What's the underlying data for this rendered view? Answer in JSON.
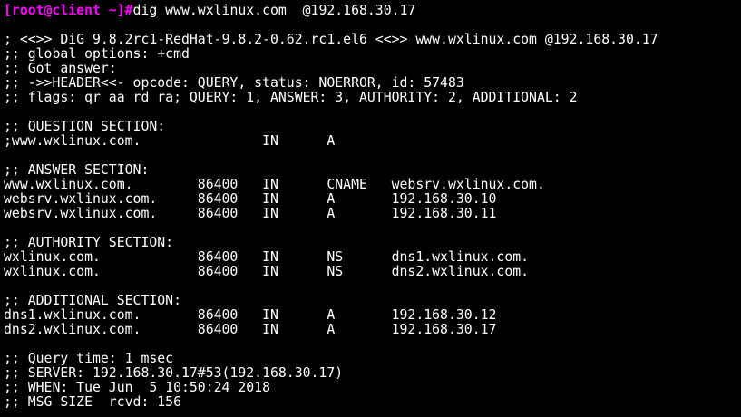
{
  "terminal": {
    "prompt": "[root@client ~]#",
    "command": "dig www.wxlinux.com  @192.168.30.17",
    "prompt_color": "#ff00ff",
    "output": [
      "",
      "; <<>> DiG 9.8.2rc1-RedHat-9.8.2-0.62.rc1.el6 <<>> www.wxlinux.com @192.168.30.17",
      ";; global options: +cmd",
      ";; Got answer:",
      ";; ->>HEADER<<- opcode: QUERY, status: NOERROR, id: 57483",
      ";; flags: qr aa rd ra; QUERY: 1, ANSWER: 3, AUTHORITY: 2, ADDITIONAL: 2",
      "",
      ";; QUESTION SECTION:",
      ";www.wxlinux.com.               IN      A",
      "",
      ";; ANSWER SECTION:",
      "www.wxlinux.com.        86400   IN      CNAME   websrv.wxlinux.com.",
      "websrv.wxlinux.com.     86400   IN      A       192.168.30.10",
      "websrv.wxlinux.com.     86400   IN      A       192.168.30.11",
      "",
      ";; AUTHORITY SECTION:",
      "wxlinux.com.            86400   IN      NS      dns1.wxlinux.com.",
      "wxlinux.com.            86400   IN      NS      dns2.wxlinux.com.",
      "",
      ";; ADDITIONAL SECTION:",
      "dns1.wxlinux.com.       86400   IN      A       192.168.30.12",
      "dns2.wxlinux.com.       86400   IN      A       192.168.30.17",
      "",
      ";; Query time: 1 msec",
      ";; SERVER: 192.168.30.17#53(192.168.30.17)",
      ";; WHEN: Tue Jun  5 10:50:24 2018",
      ";; MSG SIZE  rcvd: 156"
    ]
  }
}
